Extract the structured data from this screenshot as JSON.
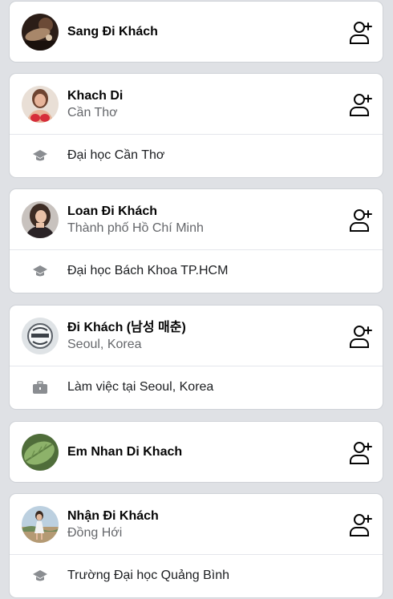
{
  "suggestions": [
    {
      "name": "Sang Đi Khách",
      "location": "",
      "detail": "",
      "detail_icon": "",
      "avatar_icon": "avatar-man-dark-icon",
      "action_icon": "add-friend-icon"
    },
    {
      "name": "Khach Di",
      "location": "Cần Thơ",
      "detail": "Đại học Cần Thơ",
      "detail_icon": "graduation-cap-icon",
      "avatar_icon": "avatar-woman-red-icon",
      "action_icon": "add-friend-icon"
    },
    {
      "name": "Loan Đi Khách",
      "location": "Thành phố Hồ Chí Minh",
      "detail": "Đại học Bách Khoa TP.HCM",
      "detail_icon": "graduation-cap-icon",
      "avatar_icon": "avatar-woman-dark-icon",
      "action_icon": "add-friend-icon"
    },
    {
      "name": "Đi Khách (남성 매춘)",
      "location": "Seoul, Korea",
      "detail": "Làm việc tại Seoul, Korea",
      "detail_icon": "briefcase-icon",
      "avatar_icon": "avatar-logo-icon",
      "action_icon": "add-friend-icon"
    },
    {
      "name": "Em Nhan Di Khach",
      "location": "",
      "detail": "",
      "detail_icon": "",
      "avatar_icon": "avatar-leaf-icon",
      "action_icon": "add-friend-icon"
    },
    {
      "name": "Nhận Đi Khách",
      "location": "Đồng Hới",
      "detail": "Trường Đại học Quảng Bình",
      "detail_icon": "graduation-cap-icon",
      "avatar_icon": "avatar-woman-outdoor-icon",
      "action_icon": "add-friend-icon"
    }
  ],
  "colors": {
    "page_background": "#dfe1e5",
    "card_background": "#ffffff",
    "name_text": "#050505",
    "secondary_text": "#65676b",
    "icon_gray": "#8a8d91"
  }
}
